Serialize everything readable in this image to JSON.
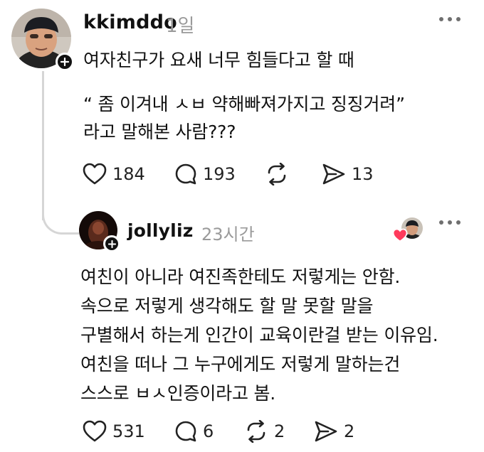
{
  "post": {
    "username": "kkimddo",
    "time": "1일",
    "lines": [
      "여자친구가 요새 너무 힘들다고 할 때",
      "“ 좀 이겨내 ㅅㅂ 약해빠져가지고 징징거려”",
      "라고 말해본 사람???"
    ],
    "likes": "184",
    "comments": "193",
    "shares": "13"
  },
  "reply": {
    "username": "jollyliz",
    "time": "23시간",
    "lines": [
      "여친이 아니라 여진족한테도 저렇게는 안함.",
      "속으로 저렇게 생각해도 할 말 못할 말을",
      "구별해서 하는게 인간이 교육이란걸 받는 이유임.",
      "여친을 떠나 그 누구에게도 저렇게 말하는건",
      "스스로 ㅂㅅ인증이라고 봄."
    ],
    "likes": "531",
    "comments": "6",
    "reposts": "2",
    "shares": "2"
  },
  "colors": {
    "text": "#111111",
    "muted": "#9a9a9a",
    "thread_line": "#d6d6d6",
    "like_heart": "#ff3b5c"
  },
  "icons": [
    "heart-icon",
    "comment-icon",
    "repost-icon",
    "share-icon",
    "more-icon",
    "plus-icon"
  ]
}
